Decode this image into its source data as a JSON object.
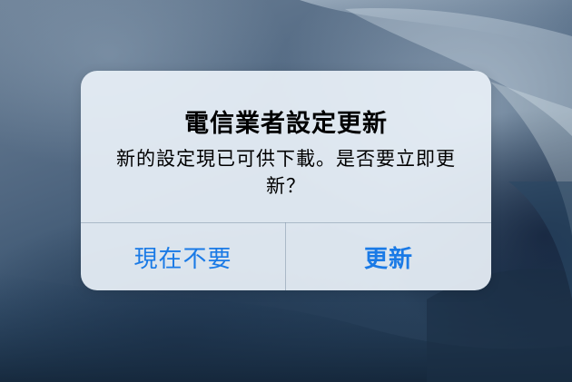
{
  "alert": {
    "title": "電信業者設定更新",
    "message": "新的設定現已可供下載。是否要立即更新？",
    "buttons": {
      "cancel_label": "現在不要",
      "update_label": "更新"
    }
  },
  "colors": {
    "button_text": "#1a7ae6",
    "alert_background": "#e8f0f8",
    "divider": "#8296aa"
  }
}
